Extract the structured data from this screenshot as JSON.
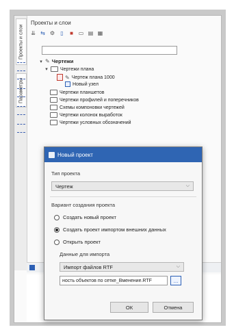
{
  "panel": {
    "title": "Проекты и слои",
    "tabs": [
      "Проекты и слои",
      "Параметры"
    ]
  },
  "tree": {
    "root": "Чертежи",
    "items": [
      {
        "label": "Чертежи плана",
        "level": 1
      },
      {
        "label": "Чертеж плана 1000",
        "level": 2
      },
      {
        "label": "Новый узел",
        "level": 2
      },
      {
        "label": "Чертежи планшетов",
        "level": 1
      },
      {
        "label": "Чертежи профилей и поперечников",
        "level": 1
      },
      {
        "label": "Схемы компоновки чертежей",
        "level": 1
      },
      {
        "label": "Чертежи колонок выработок",
        "level": 1
      },
      {
        "label": "Чертежи условных обозначений",
        "level": 1
      }
    ]
  },
  "dialog": {
    "title": "Новый проект",
    "project_type_label": "Тип проекта",
    "project_type_value": "Чертеж",
    "creation_label": "Вариант создания проекта",
    "radio_options": [
      {
        "label": "Создать новый проект",
        "checked": false
      },
      {
        "label": "Создать проект импортом внешних данных",
        "checked": true
      },
      {
        "label": "Открыть проект",
        "checked": false
      }
    ],
    "import_data_label": "Данные для импорта",
    "import_select_value": "Импорт файлов RTF",
    "file_path": "ность объектов по сетке_Вменение.RTF",
    "browse_label": "...",
    "ok_label": "ОК",
    "cancel_label": "Отмена"
  },
  "colors": {
    "accent": "#2f65b3"
  }
}
